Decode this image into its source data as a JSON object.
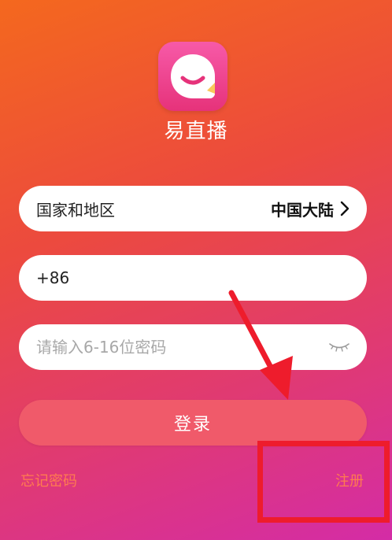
{
  "app": {
    "name": "易直播"
  },
  "region_field": {
    "label": "国家和地区",
    "value": "中国大陆"
  },
  "phone_field": {
    "value": "+86"
  },
  "password_field": {
    "placeholder": "请输入6-16位密码"
  },
  "login_button": {
    "label": "登录"
  },
  "links": {
    "forgot": "忘记密码",
    "register": "注册"
  },
  "icons": {
    "app": "chat-bubble-smile-icon",
    "chevron": "chevron-right-icon",
    "eye": "eye-closed-icon"
  },
  "colors": {
    "login_button": "#f05a6a",
    "link": "#ff7b50",
    "annotation": "#ee1c2c",
    "gradient_top": "#f4681e",
    "gradient_bottom": "#d42ca6"
  }
}
